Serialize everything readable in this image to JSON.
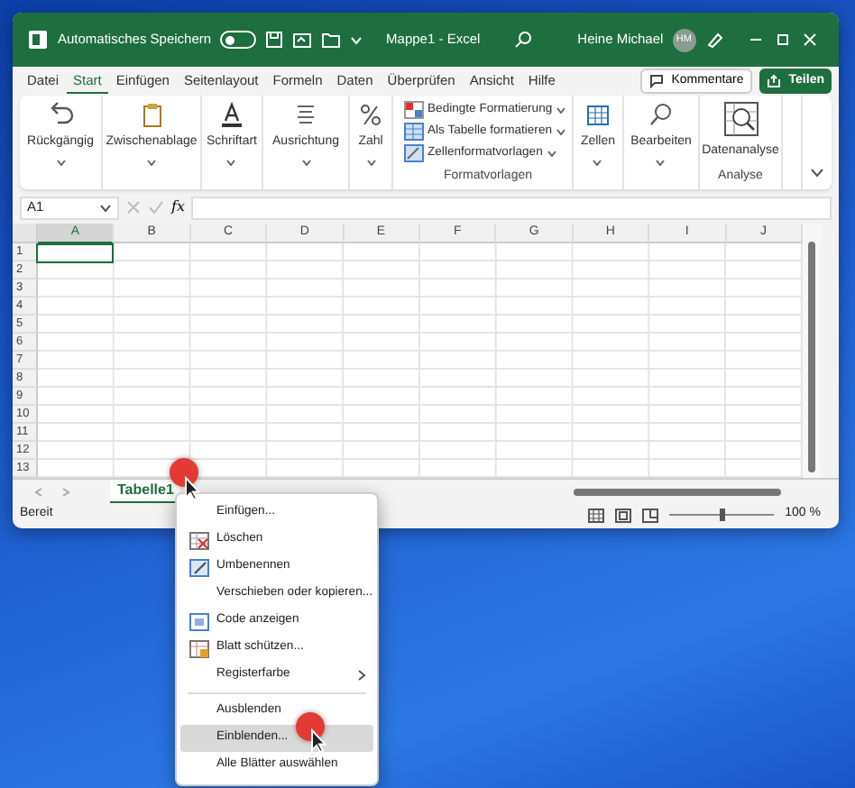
{
  "title_bar": {
    "autosave_label": "Automatisches Speichern",
    "autosave_on": false,
    "document_title": "Mappe1 - Excel",
    "user_name": "Heine Michael",
    "avatar_initials": "HM"
  },
  "ribbon_tabs": [
    {
      "label": "Datei",
      "selected": false
    },
    {
      "label": "Start",
      "selected": true
    },
    {
      "label": "Einfügen",
      "selected": false
    },
    {
      "label": "Seitenlayout",
      "selected": false
    },
    {
      "label": "Formeln",
      "selected": false
    },
    {
      "label": "Daten",
      "selected": false
    },
    {
      "label": "Überprüfen",
      "selected": false
    },
    {
      "label": "Ansicht",
      "selected": false
    },
    {
      "label": "Hilfe",
      "selected": false
    }
  ],
  "comments_button": "Kommentare",
  "share_button": "Teilen",
  "ribbon_groups": [
    {
      "kind": "button",
      "label": "Rückgängig"
    },
    {
      "kind": "button",
      "label": "Zwischenablage"
    },
    {
      "kind": "button",
      "label": "Schriftart"
    },
    {
      "kind": "button",
      "label": "Ausrichtung"
    },
    {
      "kind": "button",
      "label": "Zahl"
    },
    {
      "kind": "styles",
      "items": [
        "Bedingte Formatierung",
        "Als Tabelle formatieren",
        "Zellenformatvorlagen"
      ],
      "caption": "Formatvorlagen"
    },
    {
      "kind": "button",
      "label": "Zellen"
    },
    {
      "kind": "button",
      "label": "Bearbeiten"
    },
    {
      "kind": "analysis",
      "label": "Datenanalyse",
      "caption": "Analyse"
    }
  ],
  "name_box": "A1",
  "formula_label": "fx",
  "columns": [
    {
      "label": "A",
      "selected": true
    },
    {
      "label": "B",
      "selected": false
    },
    {
      "label": "C",
      "selected": false
    },
    {
      "label": "D",
      "selected": false
    },
    {
      "label": "E",
      "selected": false
    },
    {
      "label": "F",
      "selected": false
    },
    {
      "label": "G",
      "selected": false
    },
    {
      "label": "H",
      "selected": false
    },
    {
      "label": "I",
      "selected": false
    },
    {
      "label": "J",
      "selected": false
    }
  ],
  "rows": [
    "1",
    "2",
    "3",
    "4",
    "5",
    "6",
    "7",
    "8",
    "9",
    "10",
    "11",
    "12",
    "13"
  ],
  "sheet_tabs": [
    {
      "label": "Tabelle1",
      "selected": true
    }
  ],
  "status_bar": {
    "text": "Bereit",
    "zoom": "100 %",
    "level": 0.5
  },
  "context_menu": [
    {
      "kind": "plain",
      "label": "Einfügen...",
      "highlighted": false
    },
    {
      "kind": "delete",
      "label": "Löschen",
      "highlighted": false
    },
    {
      "kind": "rename",
      "label": "Umbenennen",
      "highlighted": false
    },
    {
      "kind": "plain",
      "label": "Verschieben oder kopieren...",
      "highlighted": false
    },
    {
      "kind": "code",
      "label": "Code anzeigen",
      "highlighted": false
    },
    {
      "kind": "protect",
      "label": "Blatt schützen...",
      "highlighted": false
    },
    {
      "kind": "submenu",
      "label": "Registerfarbe",
      "highlighted": false
    },
    {
      "kind": "separator"
    },
    {
      "kind": "plain",
      "label": "Ausblenden",
      "highlighted": false
    },
    {
      "kind": "plain",
      "label": "Einblenden...",
      "highlighted": true
    },
    {
      "kind": "plain",
      "label": "Alle Blätter auswählen",
      "highlighted": false
    }
  ]
}
